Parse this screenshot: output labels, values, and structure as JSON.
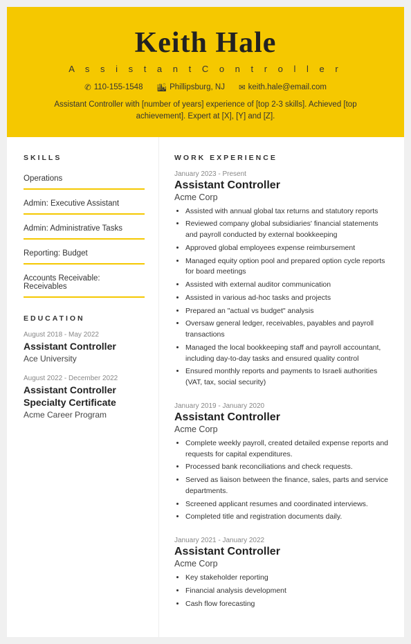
{
  "header": {
    "name": "Keith Hale",
    "title": "A s s i s t a n t   C o n t r o l l e r",
    "phone_icon": "📞",
    "phone": "110-155-1548",
    "location_icon": "🏙",
    "location": "Phillipsburg, NJ",
    "email_icon": "✉",
    "email": "keith.hale@email.com",
    "summary": "Assistant Controller with [number of years] experience of [top 2-3 skills]. Achieved [top achievement]. Expert at [X], [Y] and [Z]."
  },
  "skills": {
    "section_title": "SKILLS",
    "items": [
      "Operations",
      "Admin: Executive Assistant",
      "Admin: Administrative Tasks",
      "Reporting: Budget",
      "Accounts Receivable: Receivables"
    ]
  },
  "education": {
    "section_title": "EDUCATION",
    "entries": [
      {
        "date": "August 2018 - May 2022",
        "degree": "Assistant Controller",
        "institution": "Ace University"
      },
      {
        "date": "August 2022 - December 2022",
        "degree": "Assistant Controller Specialty Certificate",
        "institution": "Acme Career Program"
      }
    ]
  },
  "work_experience": {
    "section_title": "WORK EXPERIENCE",
    "entries": [
      {
        "date": "January 2023 - Present",
        "title": "Assistant Controller",
        "company": "Acme Corp",
        "bullets": [
          "Assisted with annual global tax returns and statutory reports",
          "Reviewed company global subsidiaries' financial statements and payroll conducted by external bookkeeping",
          "Approved global employees expense reimbursement",
          "Managed equity option pool and prepared option cycle reports for board meetings",
          "Assisted with external auditor communication",
          "Assisted in various ad-hoc tasks and projects",
          "Prepared an \"actual vs budget\" analysis",
          "Oversaw general ledger, receivables, payables and payroll transactions",
          "Managed the local bookkeeping staff and payroll accountant, including day-to-day tasks and ensured quality control",
          "Ensured monthly reports and payments to Israeli authorities (VAT, tax, social security)"
        ]
      },
      {
        "date": "January 2019 - January 2020",
        "title": "Assistant Controller",
        "company": "Acme Corp",
        "bullets": [
          "Complete weekly payroll, created detailed expense reports and requests for capital expenditures.",
          "Processed bank reconciliations and check requests.",
          "Served as liaison between the finance, sales, parts and service departments.",
          "Screened applicant resumes and coordinated interviews.",
          "Completed title and registration documents daily."
        ]
      },
      {
        "date": "January 2021 - January 2022",
        "title": "Assistant Controller",
        "company": "Acme Corp",
        "bullets": [
          "Key stakeholder reporting",
          "Financial analysis development",
          "Cash flow forecasting"
        ]
      }
    ]
  }
}
